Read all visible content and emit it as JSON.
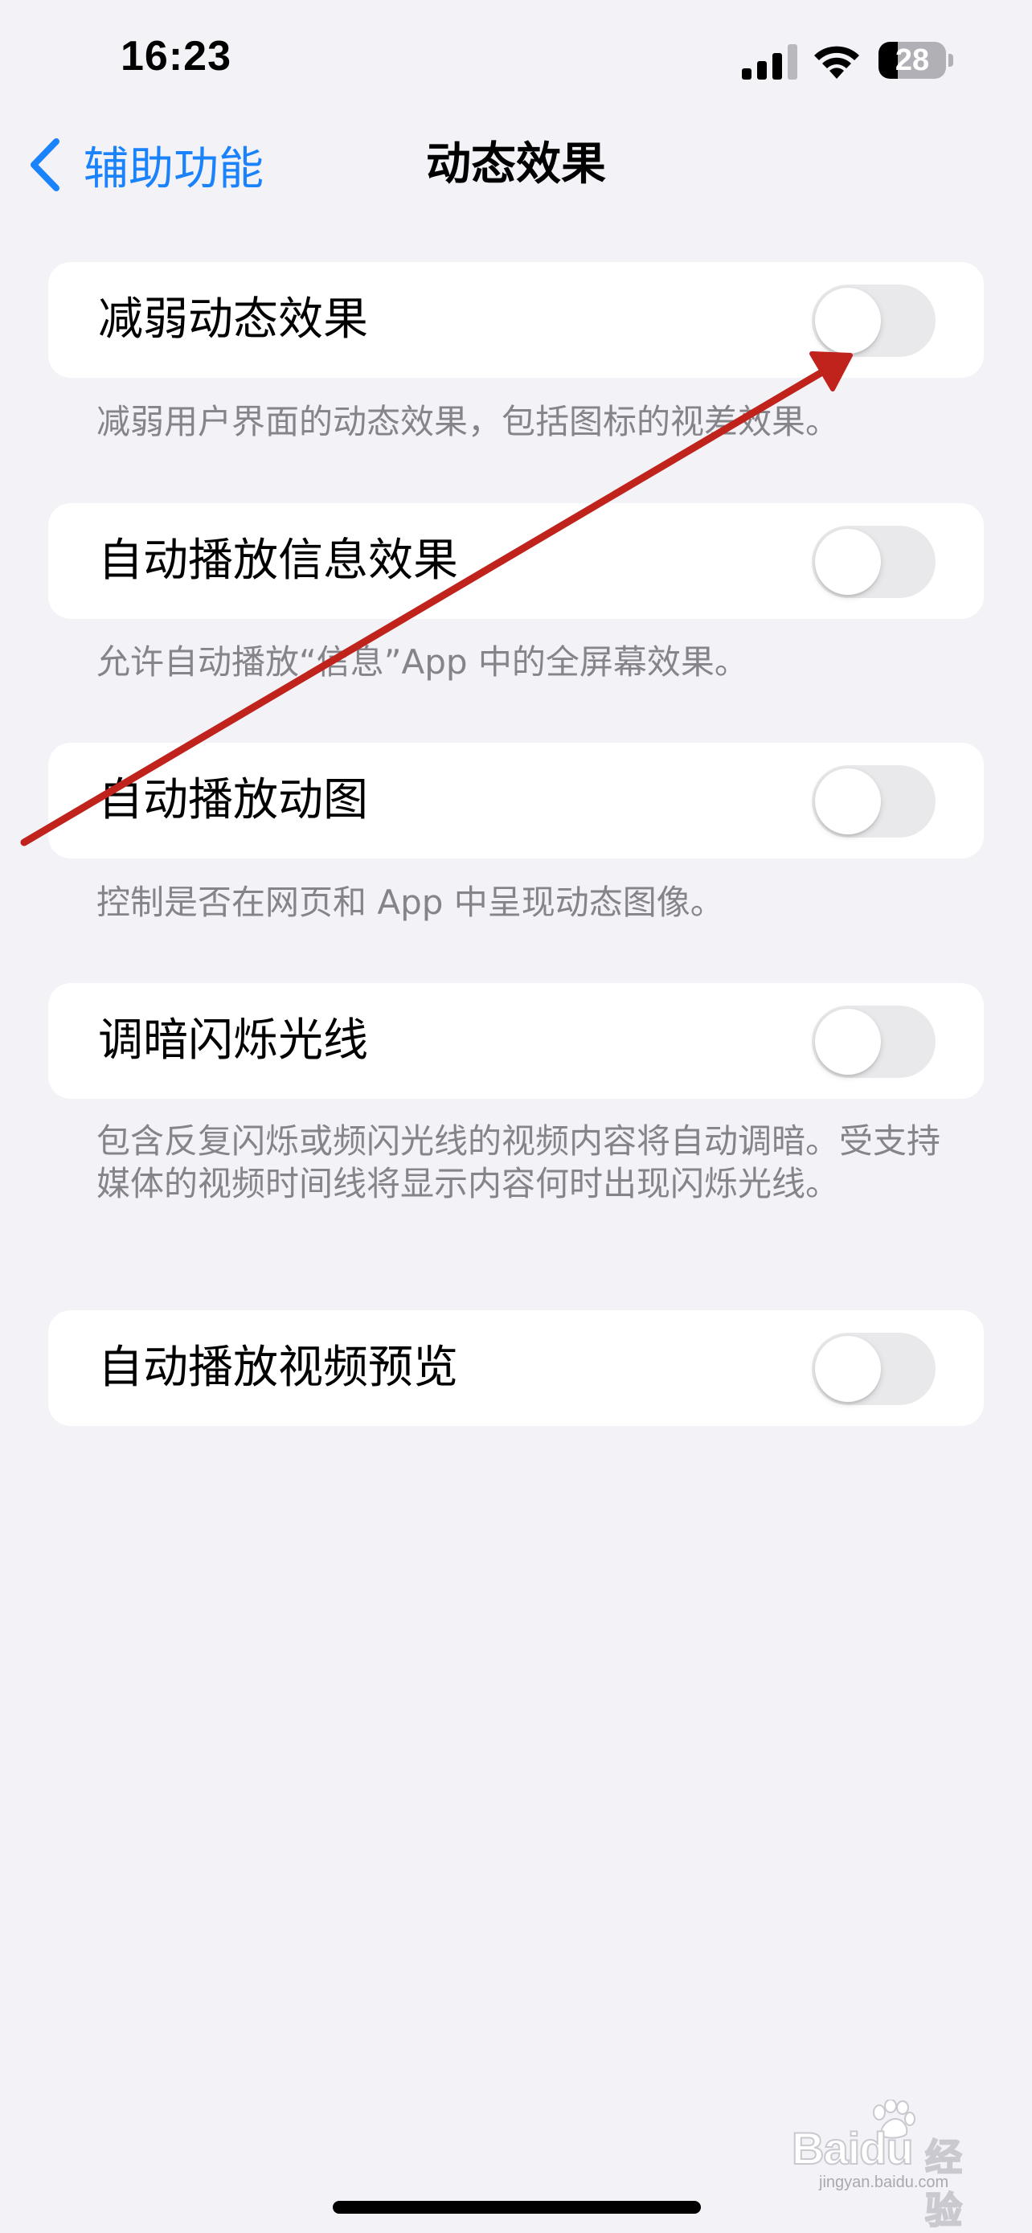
{
  "status_bar": {
    "time": "16:23",
    "battery_level": "28",
    "battery_fraction": 0.28,
    "icons": [
      "signal-icon",
      "wifi-icon",
      "battery-icon"
    ]
  },
  "nav": {
    "back_label": "辅助功能",
    "title": "动态效果",
    "back_icon": "chevron-left-icon"
  },
  "colors": {
    "accent": "#1a82fb",
    "background": "#f2f2f7",
    "toggle_off": "#e9e9eb",
    "footnote": "#84848a",
    "annotation_arrow": "#c0221c"
  },
  "settings": [
    {
      "label": "减弱动态效果",
      "enabled": false,
      "footnote": "减弱用户界面的动态效果，包括图标的视差效果。"
    },
    {
      "label": "自动播放信息效果",
      "enabled": false,
      "footnote": "允许自动播放“信息”App 中的全屏幕效果。"
    },
    {
      "label": "自动播放动图",
      "enabled": false,
      "footnote": "控制是否在网页和 App 中呈现动态图像。"
    },
    {
      "label": "调暗闪烁光线",
      "enabled": false,
      "footnote": "包含反复闪烁或频闪光线的视频内容将自动调暗。受支持媒体的视频时间线将显示内容何时出现闪烁光线。"
    },
    {
      "label": "自动播放视频预览",
      "enabled": false
    }
  ],
  "watermark": {
    "text": "Baidu",
    "cn": "经验",
    "url": "jingyan.baidu.com"
  }
}
